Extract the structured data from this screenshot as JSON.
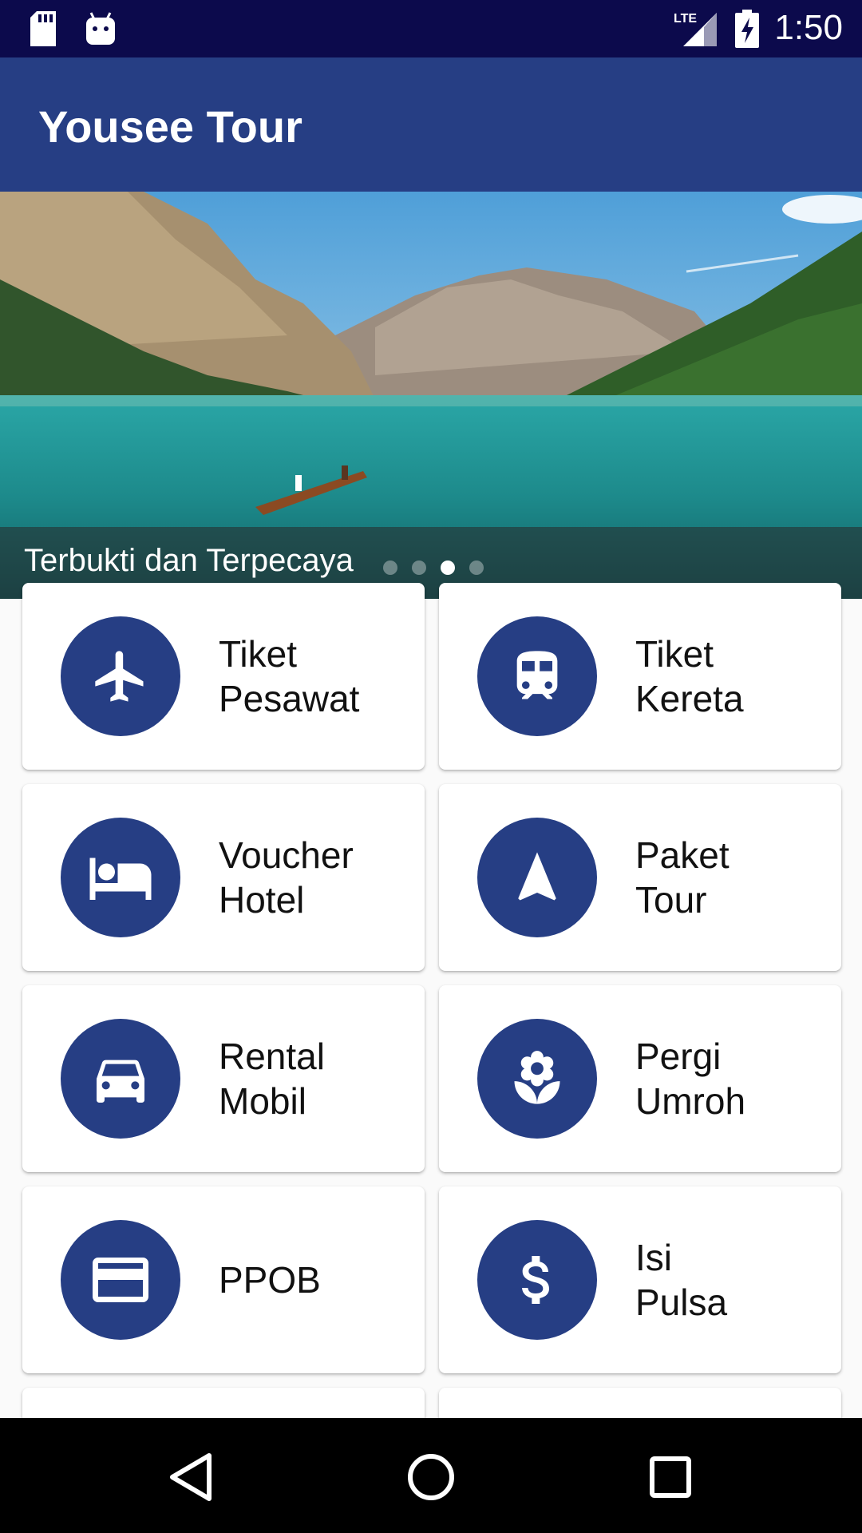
{
  "status_bar": {
    "time": "1:50",
    "network": "LTE",
    "icons": [
      "sd-card-icon",
      "android-debug-icon",
      "lte-signal-icon",
      "battery-charging-icon"
    ]
  },
  "app_bar": {
    "title": "Yousee Tour"
  },
  "banner": {
    "caption": "Terbukti dan Terpecaya",
    "slide_count": 4,
    "active_slide": 2
  },
  "menu": [
    {
      "line1": "Tiket",
      "line2": "Pesawat",
      "icon": "airplane-icon"
    },
    {
      "line1": "Tiket",
      "line2": "Kereta",
      "icon": "train-icon"
    },
    {
      "line1": "Voucher",
      "line2": "Hotel",
      "icon": "hotel-bed-icon"
    },
    {
      "line1": "Paket",
      "line2": "Tour",
      "icon": "navigation-arrow-icon"
    },
    {
      "line1": "Rental",
      "line2": "Mobil",
      "icon": "car-icon"
    },
    {
      "line1": "Pergi",
      "line2": "Umroh",
      "icon": "flower-icon"
    },
    {
      "line1": "PPOB",
      "line2": "",
      "icon": "credit-card-icon"
    },
    {
      "line1": "Isi",
      "line2": "Pulsa",
      "icon": "dollar-icon"
    }
  ],
  "nav": {
    "icons": [
      "back-icon",
      "home-icon",
      "recents-icon"
    ]
  },
  "colors": {
    "primary": "#263e84",
    "status_bar": "#0c0a4c",
    "background": "#fafafa"
  }
}
